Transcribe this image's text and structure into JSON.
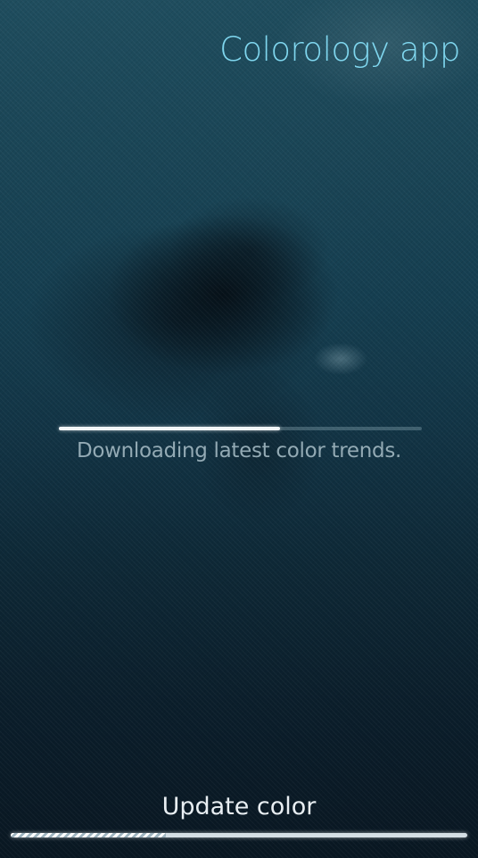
{
  "app": {
    "title": "Colorology app"
  },
  "download": {
    "status_text": "Downloading latest color trends.",
    "progress": 0.61
  },
  "pulley_action": {
    "label": "Update color",
    "busy_fraction": 0.34
  },
  "colors": {
    "title_accent": "#7fd6ee",
    "status_text": "#93aab4",
    "background_top": "#1f4d5e",
    "background_bottom": "#091722"
  }
}
